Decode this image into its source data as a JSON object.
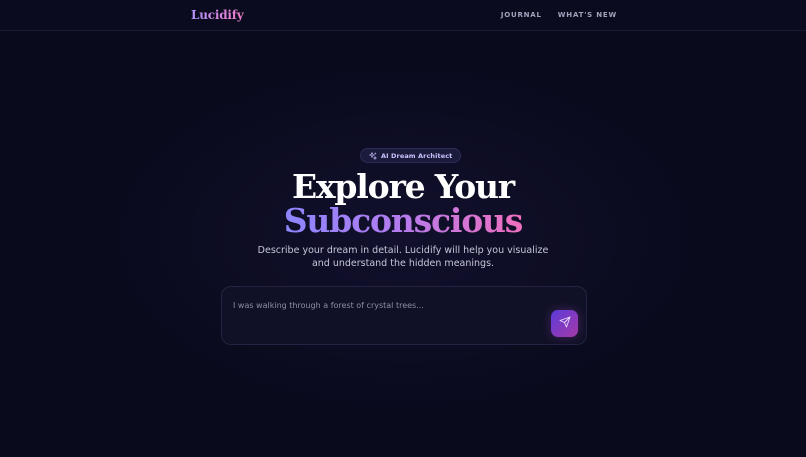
{
  "header": {
    "brand": "Lucidify",
    "nav": [
      {
        "label": "JOURNAL"
      },
      {
        "label": "WHAT'S NEW"
      }
    ]
  },
  "hero": {
    "badge": {
      "icon": "sparkles-icon",
      "label": "AI Dream Architect"
    },
    "title_line1": "Explore Your",
    "title_line2": "Subconscious",
    "subtitle_line1": "Describe your dream in detail. Lucidify will help you visualize",
    "subtitle_line2": "and understand the hidden meanings."
  },
  "composer": {
    "placeholder": "I was walking through a forest of crystal trees...",
    "value": "",
    "send_icon": "send-icon"
  },
  "colors": {
    "background": "#090a1c",
    "accent_start": "#8b86ff",
    "accent_end": "#ef6fbf",
    "button_start": "#5c3bd9",
    "button_end": "#a43aa8"
  }
}
